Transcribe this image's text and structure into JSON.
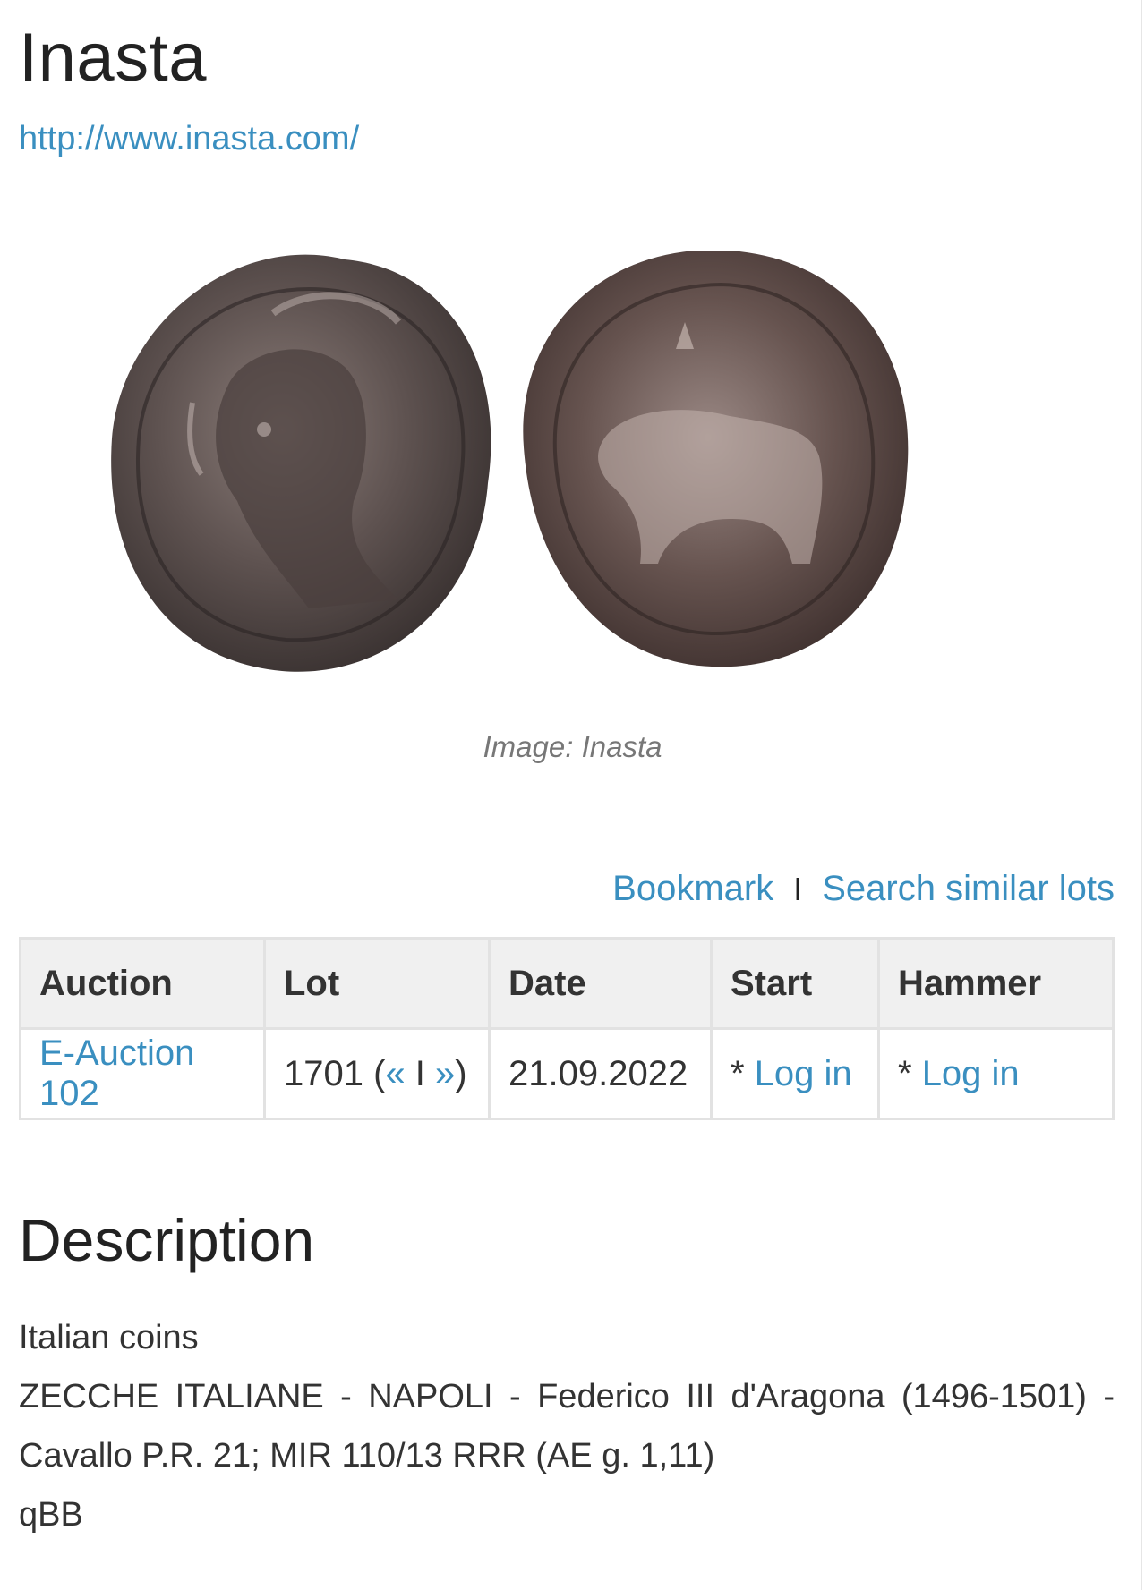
{
  "header": {
    "title": "Inasta",
    "url": "http://www.inasta.com/"
  },
  "image": {
    "caption": "Image: Inasta",
    "obverse_alt": "coin-obverse",
    "reverse_alt": "coin-reverse"
  },
  "actions": {
    "bookmark": "Bookmark",
    "separator": "I",
    "search_similar": "Search similar lots"
  },
  "table": {
    "headers": [
      "Auction",
      "Lot",
      "Date",
      "Start",
      "Hammer"
    ],
    "row": {
      "auction": "E-Auction 102",
      "lot_number": "1701 (",
      "lot_prev": "«",
      "lot_sep": " I ",
      "lot_next": "»",
      "lot_close": ")",
      "date": "21.09.2022",
      "start_prefix": "* ",
      "start_link": "Log in",
      "hammer_prefix": "* ",
      "hammer_link": "Log in"
    }
  },
  "description": {
    "heading": "Description",
    "category": "Italian coins",
    "text": "ZECCHE ITALIANE - NAPOLI - Federico III d'Aragona (1496-1501) - Cavallo P.R. 21; MIR 110/13 RRR (AE g. 1,11)",
    "grade": "qBB"
  },
  "colors": {
    "link": "#3a8fc0",
    "table_header_bg": "#f0f0f0",
    "border": "#e2e2e2"
  }
}
